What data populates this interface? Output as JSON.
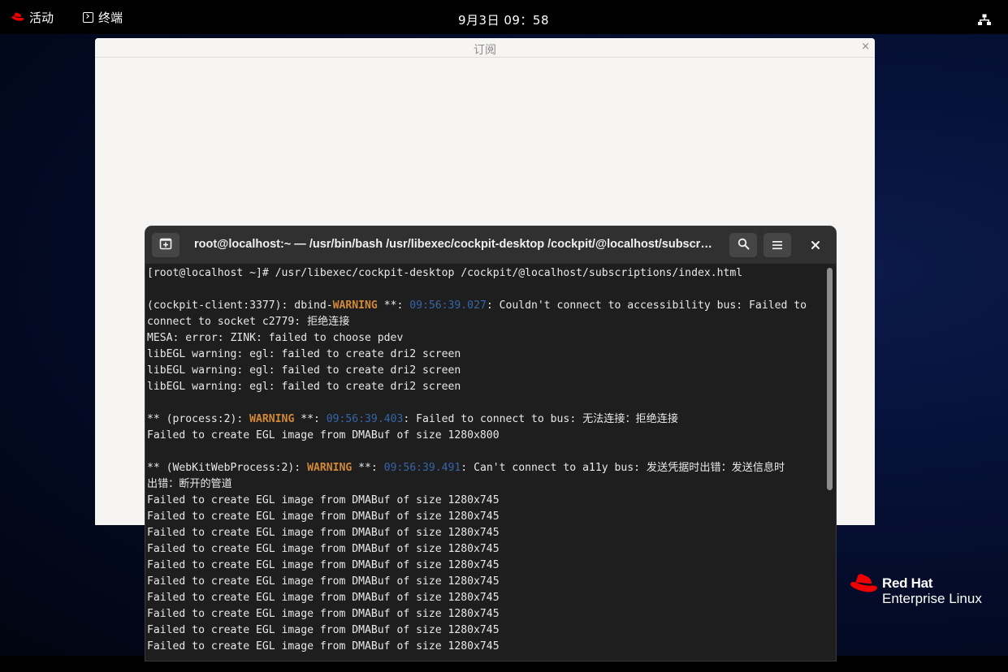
{
  "topbar": {
    "activities_label": "活动",
    "app_label": "终端",
    "clock": "9月3日 09：58",
    "network_icon": "network-wired-icon"
  },
  "subscription_window": {
    "title": "订阅",
    "close_glyph": "×"
  },
  "branding": {
    "line1": "Red Hat",
    "line2": "Enterprise Linux",
    "logo_color": "#ee0000"
  },
  "terminal": {
    "title": "root@localhost:~ — /usr/bin/bash /usr/libexec/cockpit-desktop /cockpit/@localhost/subscriptions/index.html",
    "buttons": {
      "new_tab_icon": "new-tab-icon",
      "search_icon": "search-icon",
      "menu_icon": "hamburger-menu-icon",
      "close_icon": "close-icon"
    },
    "colors": {
      "warning": "#d38938",
      "timestamp": "#3566a9",
      "text": "#e8e8e8",
      "background": "#1e1e1e"
    },
    "lines": [
      {
        "text": "[root@localhost ~]# /usr/libexec/cockpit-desktop /cockpit/@localhost/subscriptions/index.html"
      },
      {
        "text": ""
      },
      {
        "pre": "(cockpit-client:3377): dbind-",
        "warn": "WARNING",
        "mid": " **: ",
        "ts": "09:56:39.027",
        "post": ": Couldn't connect to accessibility bus: Failed to"
      },
      {
        "text": "connect to socket c2779: 拒绝连接"
      },
      {
        "text": "MESA: error: ZINK: failed to choose pdev"
      },
      {
        "text": "libEGL warning: egl: failed to create dri2 screen"
      },
      {
        "text": "libEGL warning: egl: failed to create dri2 screen"
      },
      {
        "text": "libEGL warning: egl: failed to create dri2 screen"
      },
      {
        "text": ""
      },
      {
        "pre": "** (process:2): ",
        "warn": "WARNING",
        "mid": " **: ",
        "ts": "09:56:39.403",
        "post": ": Failed to connect to bus: 无法连接：拒绝连接"
      },
      {
        "text": "Failed to create EGL image from DMABuf of size 1280x800"
      },
      {
        "text": ""
      },
      {
        "pre": "** (WebKitWebProcess:2): ",
        "warn": "WARNING",
        "mid": " **: ",
        "ts": "09:56:39.491",
        "post": ": Can't connect to a11y bus: 发送凭据时出错：发送信息时"
      },
      {
        "text": "出错：断开的管道"
      },
      {
        "text": "Failed to create EGL image from DMABuf of size 1280x745"
      },
      {
        "text": "Failed to create EGL image from DMABuf of size 1280x745"
      },
      {
        "text": "Failed to create EGL image from DMABuf of size 1280x745"
      },
      {
        "text": "Failed to create EGL image from DMABuf of size 1280x745"
      },
      {
        "text": "Failed to create EGL image from DMABuf of size 1280x745"
      },
      {
        "text": "Failed to create EGL image from DMABuf of size 1280x745"
      },
      {
        "text": "Failed to create EGL image from DMABuf of size 1280x745"
      },
      {
        "text": "Failed to create EGL image from DMABuf of size 1280x745"
      },
      {
        "text": "Failed to create EGL image from DMABuf of size 1280x745"
      },
      {
        "text": "Failed to create EGL image from DMABuf of size 1280x745"
      }
    ]
  }
}
